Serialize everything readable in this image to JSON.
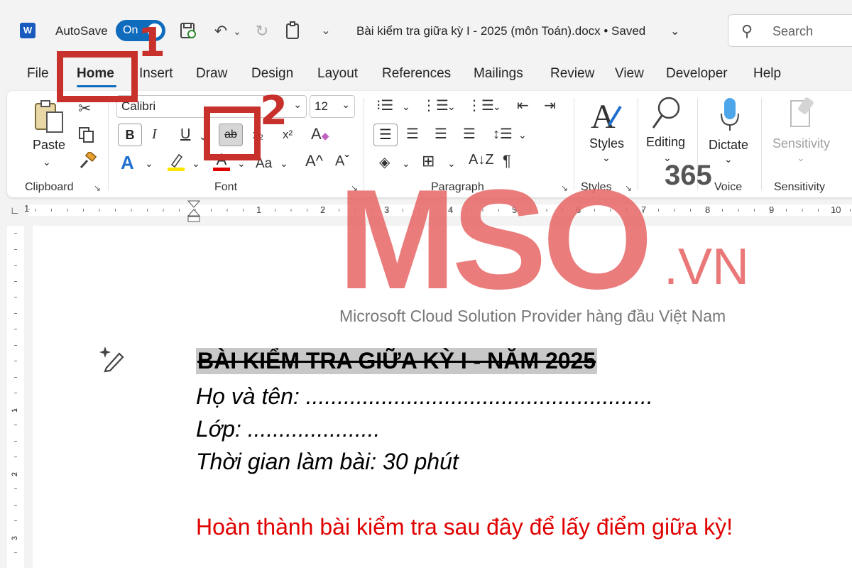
{
  "title_bar": {
    "app_icon": "W",
    "autosave_label": "AutoSave",
    "autosave_state": "On",
    "document_title": "Bài kiểm tra giữa kỳ I - 2025 (môn Toán).docx  •  Saved",
    "search_placeholder": "Search",
    "icons": [
      "word-icon",
      "save-icon",
      "undo-icon",
      "redo-icon",
      "clipboard-icon",
      "customize-icon",
      "chevron-down-icon",
      "search-icon"
    ]
  },
  "tabs": [
    "File",
    "Home",
    "Insert",
    "Draw",
    "Design",
    "Layout",
    "References",
    "Mailings",
    "Review",
    "View",
    "Developer",
    "Help"
  ],
  "ribbon": {
    "clipboard": {
      "paste_label": "Paste",
      "group_label": "Clipboard"
    },
    "font": {
      "font_name": "Calibri",
      "font_size": "12",
      "group_label": "Font",
      "bold": "B",
      "italic": "I",
      "underline": "U",
      "strike": "ab",
      "subscript": "x₂",
      "superscript": "x²",
      "change_case": "Aa",
      "grow": "A^",
      "shrink": "Aˇ",
      "font_color_letter": "A",
      "text_effects_letter": "A"
    },
    "paragraph": {
      "group_label": "Paragraph",
      "show_marks": "¶"
    },
    "styles": {
      "label": "Styles",
      "group_label": "Styles"
    },
    "editing": {
      "label": "Editing"
    },
    "voice": {
      "label": "Dictate",
      "group_label": "Voice"
    },
    "sensitivity": {
      "label": "Sensitivity",
      "group_label": "Sensitivity"
    }
  },
  "ruler": {
    "numbers": [
      "1",
      "1",
      "2",
      "3",
      "4",
      "5",
      "6",
      "7",
      "8",
      "9",
      "10"
    ],
    "vertical_numbers": [
      "1",
      "2",
      "3"
    ]
  },
  "document": {
    "heading": "BÀI KIỂM TRA GIỮA KỲ I - NĂM 2025",
    "line_name": "Họ và tên: .......................................................",
    "line_class": "Lớp: .....................",
    "line_time": "Thời gian làm bài: 30 phút",
    "line_instruction": "Hoàn thành bài kiểm tra sau đây để lấy điểm giữa kỳ!"
  },
  "watermark": {
    "brand": "MSO",
    "suffix": ".VN",
    "badge": "365",
    "tagline": "Microsoft Cloud Solution Provider hàng đầu Việt Nam"
  },
  "annotations": {
    "step1": "1",
    "step2": "2"
  },
  "colors": {
    "accent": "#0f6cbd",
    "annotation": "#c8302c",
    "watermark": "#e86a6a",
    "instruction_text": "#e00000"
  }
}
